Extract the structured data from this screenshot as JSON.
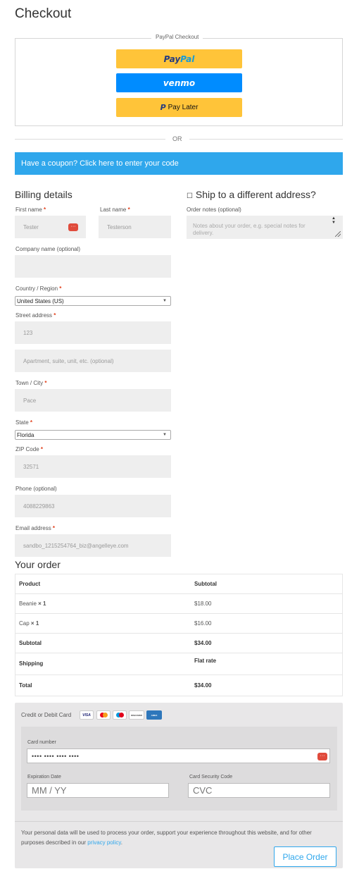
{
  "page": {
    "title": "Checkout"
  },
  "paypal": {
    "legend": "PayPal Checkout",
    "paypal_pay": "Pay",
    "paypal_pal": "Pal",
    "venmo_label": "venmo",
    "pay_later_label": "Pay Later",
    "colors": {
      "gold": "#ffc439",
      "blue": "#008cff"
    }
  },
  "divider_text": "OR",
  "coupon": {
    "text": "Have a coupon? Click here to enter your code",
    "color": "#2fa7ec"
  },
  "billing": {
    "heading": "Billing details",
    "first_name": {
      "label": "First name",
      "value": "Tester"
    },
    "last_name": {
      "label": "Last name",
      "value": "Testerson"
    },
    "company": {
      "label": "Company name (optional)",
      "value": ""
    },
    "country": {
      "label": "Country / Region",
      "value": "United States (US)"
    },
    "street": {
      "label": "Street address",
      "value": "123",
      "placeholder2": "Apartment, suite, unit, etc. (optional)"
    },
    "city": {
      "label": "Town / City",
      "value": "Pace"
    },
    "state": {
      "label": "State",
      "value": "Florida"
    },
    "zip": {
      "label": "ZIP Code",
      "value": "32571"
    },
    "phone": {
      "label": "Phone (optional)",
      "value": "4088229863"
    },
    "email": {
      "label": "Email address",
      "value": "sandbo_1215254764_biz@angelleye.com"
    },
    "required_mark": "*"
  },
  "shipping": {
    "checkbox_label": "Ship to a different address?",
    "notes_label": "Order notes (optional)",
    "notes_placeholder": "Notes about your order, e.g. special notes for delivery."
  },
  "order": {
    "heading": "Your order",
    "header": {
      "product": "Product",
      "subtotal": "Subtotal"
    },
    "items": [
      {
        "name": "Beanie",
        "qty": "× 1",
        "price": "$18.00"
      },
      {
        "name": "Cap",
        "qty": "× 1",
        "price": "$16.00"
      }
    ],
    "subtotal": {
      "label": "Subtotal",
      "value": "$34.00"
    },
    "shipping": {
      "label": "Shipping",
      "value": "Flat rate"
    },
    "total": {
      "label": "Total",
      "value": "$34.00"
    }
  },
  "payment": {
    "method_label": "Credit or Debit Card",
    "brands": [
      "VISA",
      "MC",
      "Maestro",
      "DISCOVER",
      "AMEX"
    ],
    "card_number_label": "Card number",
    "card_number_value": "•••• •••• •••• ••••",
    "expiry_label": "Expiration Date",
    "expiry_placeholder": "MM / YY",
    "cvc_label": "Card Security Code",
    "cvc_placeholder": "CVC",
    "privacy_text": "Your personal data will be used to process your order, support your experience throughout this website, and for other purposes described in our",
    "privacy_link": "privacy policy",
    "privacy_end": ".",
    "place_order": "Place Order"
  }
}
